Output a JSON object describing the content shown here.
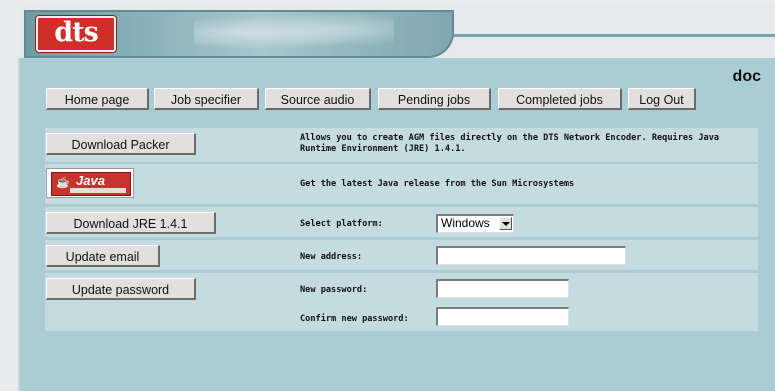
{
  "header": {
    "logo_text": "dts",
    "username": "doc"
  },
  "nav": {
    "items": [
      {
        "label": "Home page"
      },
      {
        "label": "Job specifier"
      },
      {
        "label": "Source audio"
      },
      {
        "label": "Pending jobs"
      },
      {
        "label": "Completed jobs"
      },
      {
        "label": "Log Out"
      }
    ]
  },
  "packer": {
    "button_label": "Download Packer",
    "description": "Allows you to create AGM files directly on the DTS Network Encoder. Requires Java Runtime Environment (JRE) 1.4.1."
  },
  "java": {
    "badge_text": "Java",
    "description": "Get the latest Java release from the Sun Microsystems"
  },
  "jre": {
    "button_label": "Download JRE 1.4.1",
    "platform_label": "Select platform:",
    "platform_value": "Windows"
  },
  "email": {
    "button_label": "Update email",
    "address_label": "New address:",
    "address_value": ""
  },
  "password": {
    "button_label": "Update password",
    "new_label": "New password:",
    "confirm_label": "Confirm new password:",
    "new_value": "",
    "confirm_value": ""
  },
  "colors": {
    "page_bg": "#aacdd3",
    "panel_bg": "#c4dce0",
    "logo_red": "#cf2f26"
  }
}
